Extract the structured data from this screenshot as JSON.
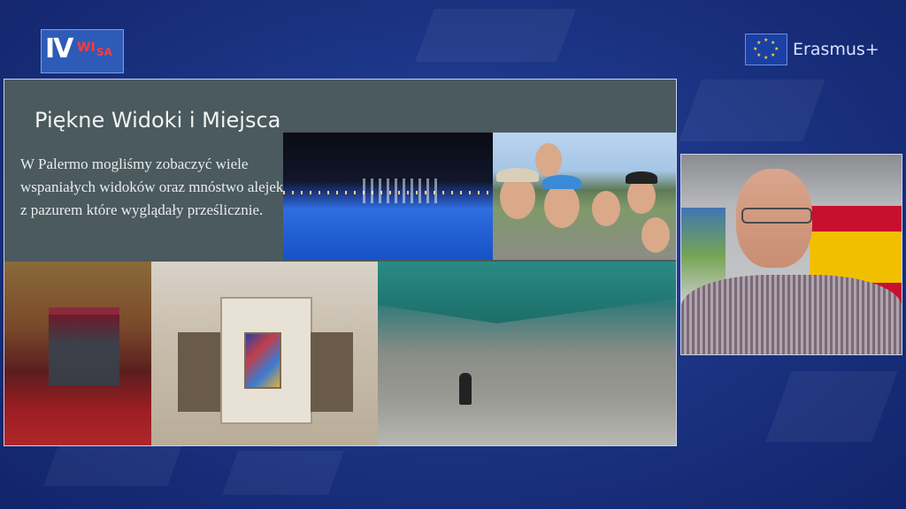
{
  "logo": {
    "letters_main": "IV",
    "letters_red_1": "WI",
    "letters_red_2": "SA"
  },
  "erasmus": {
    "label": "Erasmus+",
    "icon": "eu-flag-icon",
    "color": "#1b3fa3"
  },
  "slide": {
    "title": "Piękne Widoki i Miejsca",
    "body": "W Palermo mogliśmy zobaczyć wiele wspaniałych widoków oraz mnóstwo alejek z pazurem które wyglądały prześlicznie.",
    "background": "#4a5a5f",
    "photos": [
      "fountain-night-photo",
      "group-selfie-photo",
      "theatre-interior-photo",
      "church-altar-photo",
      "market-street-photo"
    ]
  },
  "camera": {
    "description_icon": "presenter-video-feed"
  }
}
